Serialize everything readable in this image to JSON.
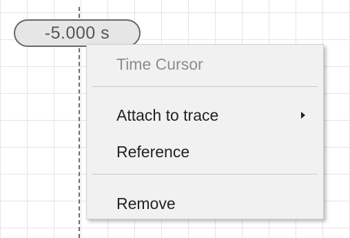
{
  "cursor": {
    "time_label": "-5.000 s"
  },
  "context_menu": {
    "title": "Time Cursor",
    "items": [
      {
        "label": "Attach to trace",
        "has_submenu": true
      },
      {
        "label": "Reference",
        "has_submenu": false
      },
      {
        "label": "Remove",
        "has_submenu": false
      }
    ]
  },
  "icons": {
    "submenu": "chevron-right-icon"
  },
  "colors": {
    "grid_line": "#e4e4e4",
    "menu_background": "#f1f1f1",
    "cursor_label_background": "#e6e6e6",
    "disabled_text": "#8c8c8c"
  }
}
